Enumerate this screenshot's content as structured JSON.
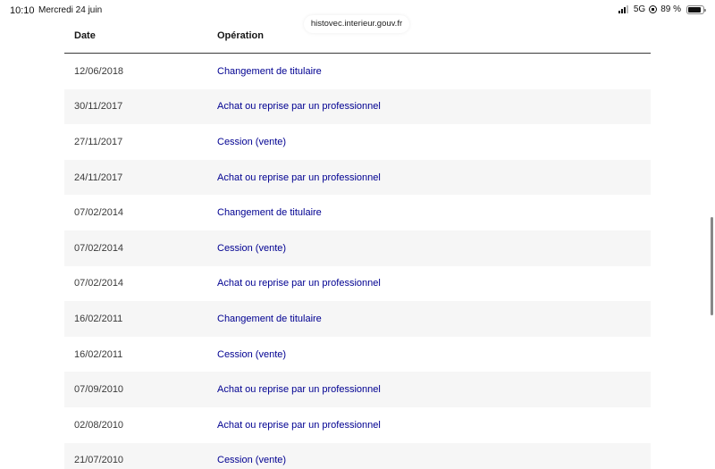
{
  "status_bar": {
    "time": "10:10",
    "date": "Mercredi 24 juin",
    "network": "5G",
    "battery": "89 %"
  },
  "browser": {
    "url": "histovec.interieur.gouv.fr"
  },
  "table": {
    "headers": {
      "date": "Date",
      "operation": "Opération"
    },
    "rows": [
      {
        "date": "12/06/2018",
        "operation": "Changement de titulaire"
      },
      {
        "date": "30/11/2017",
        "operation": "Achat ou reprise par un professionnel"
      },
      {
        "date": "27/11/2017",
        "operation": "Cession (vente)"
      },
      {
        "date": "24/11/2017",
        "operation": "Achat ou reprise par un professionnel"
      },
      {
        "date": "07/02/2014",
        "operation": "Changement de titulaire"
      },
      {
        "date": "07/02/2014",
        "operation": "Cession (vente)"
      },
      {
        "date": "07/02/2014",
        "operation": "Achat ou reprise par un professionnel"
      },
      {
        "date": "16/02/2011",
        "operation": "Changement de titulaire"
      },
      {
        "date": "16/02/2011",
        "operation": "Cession (vente)"
      },
      {
        "date": "07/09/2010",
        "operation": "Achat ou reprise par un professionnel"
      },
      {
        "date": "02/08/2010",
        "operation": "Achat ou reprise par un professionnel"
      },
      {
        "date": "21/07/2010",
        "operation": "Cession (vente)"
      }
    ]
  },
  "colors": {
    "link": "#000091",
    "row_alt_bg": "#f6f6f6",
    "header_border": "#3a3a3a"
  },
  "icons": {
    "signal": "signal-bars-icon",
    "orientation_lock": "orientation-lock-icon",
    "battery": "battery-icon"
  }
}
